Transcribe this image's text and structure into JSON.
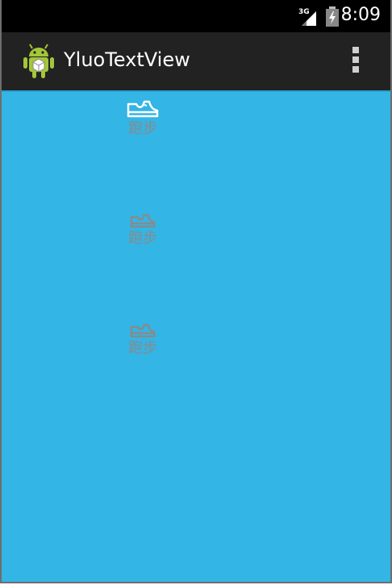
{
  "status_bar": {
    "network": "3G",
    "time": "8:09"
  },
  "action_bar": {
    "title": "YluoTextView"
  },
  "items": [
    {
      "label": "跑步",
      "icon": "shoe-icon",
      "state": "selected"
    },
    {
      "label": "跑步",
      "icon": "shoe-icon",
      "state": "normal"
    },
    {
      "label": "跑步",
      "icon": "shoe-icon",
      "state": "normal"
    }
  ],
  "colors": {
    "content_background": "#33b5e5",
    "action_bar": "#222222",
    "status_bar": "#000000",
    "selected_icon": "#ffffff",
    "normal_icon": "#8a8a8a",
    "label_text": "#8a8a8a"
  }
}
